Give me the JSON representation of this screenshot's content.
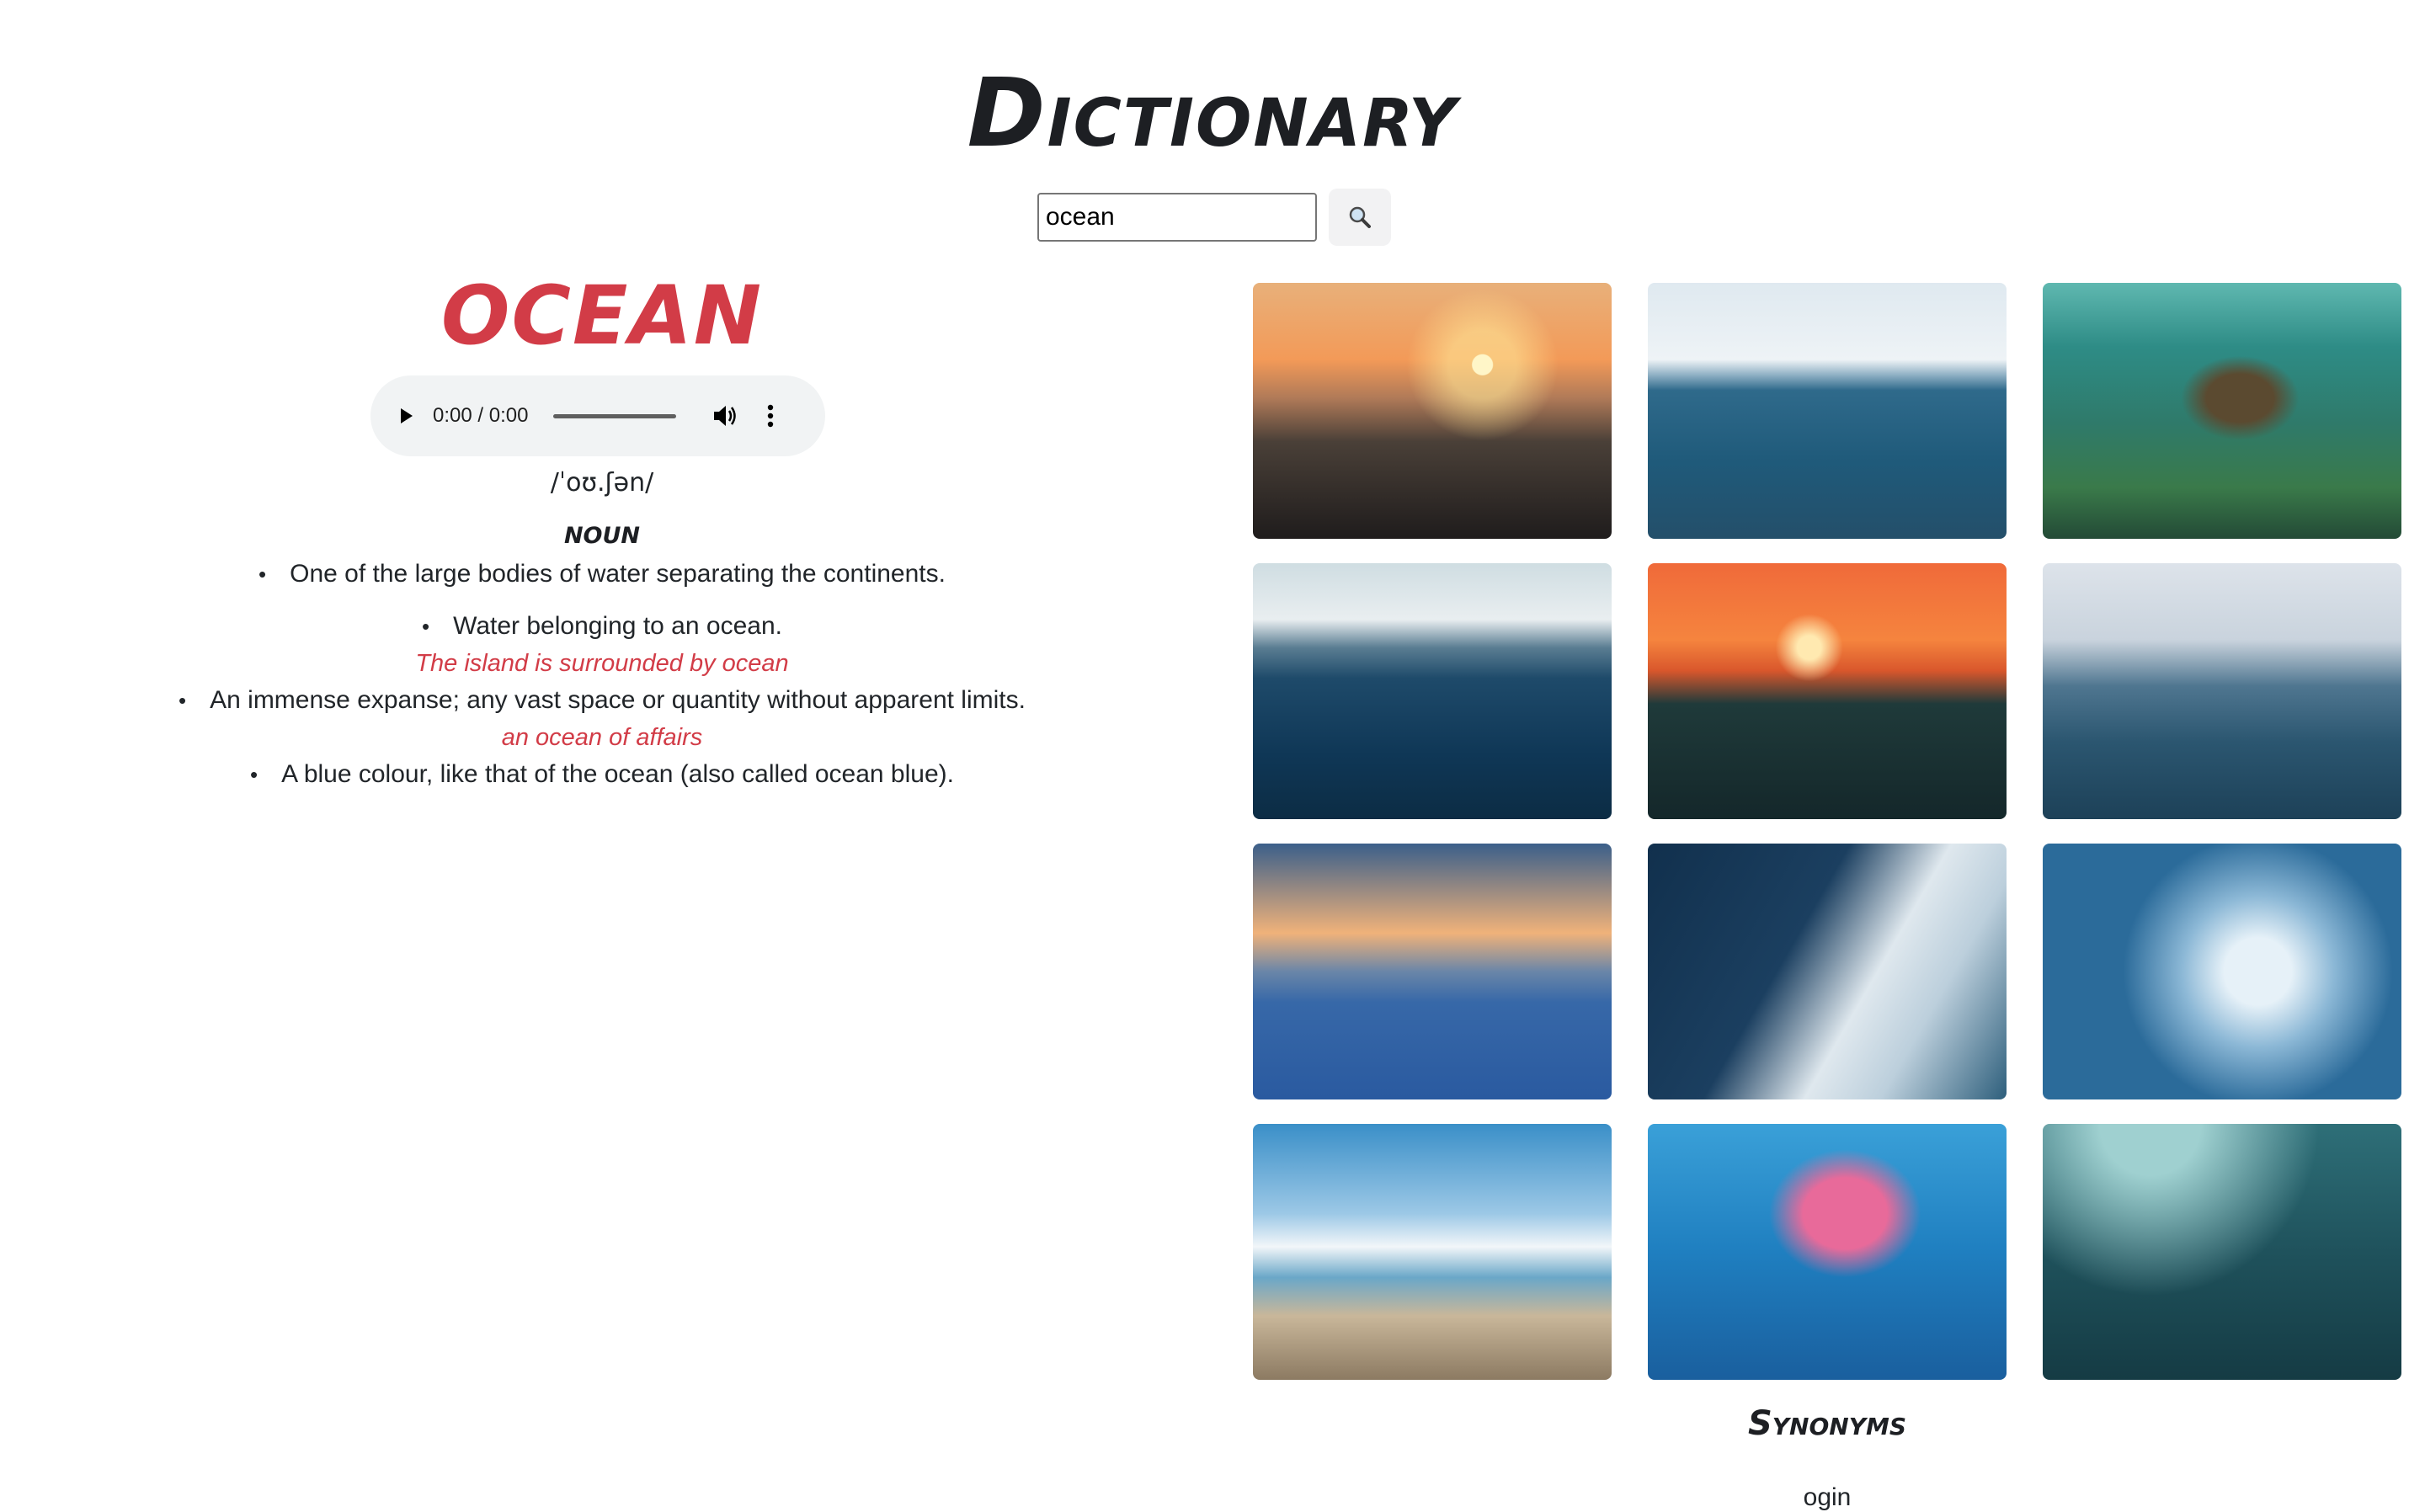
{
  "app": {
    "title": "Dictionary"
  },
  "search": {
    "value": "ocean",
    "button_icon": "search-icon"
  },
  "word": {
    "heading": "ocean",
    "audio": {
      "time": "0:00 / 0:00"
    },
    "phonetic": "/ˈoʊ.ʃən/",
    "part_of_speech": "noun",
    "definitions": [
      {
        "text": "One of the large bodies of water separating the continents.",
        "example": ""
      },
      {
        "text": "Water belonging to an ocean.",
        "example": "The island is surrounded by ocean"
      },
      {
        "text": "An immense expanse; any vast space or quantity without apparent limits.",
        "example": "an ocean of affairs"
      },
      {
        "text": "A blue colour, like that of the ocean (also called ocean blue).",
        "example": ""
      }
    ]
  },
  "photos": [
    {
      "subject": "sunset-waves"
    },
    {
      "subject": "open-sea"
    },
    {
      "subject": "sea-turtle"
    },
    {
      "subject": "rough-sea"
    },
    {
      "subject": "orange-sunset"
    },
    {
      "subject": "calm-water"
    },
    {
      "subject": "cloudy-horizon"
    },
    {
      "subject": "breaking-wave"
    },
    {
      "subject": "white-foam"
    },
    {
      "subject": "tropical-beach"
    },
    {
      "subject": "jellyfish"
    },
    {
      "subject": "underwater-light"
    }
  ],
  "synonyms": {
    "heading": "Synonyms",
    "items": [
      "ogin"
    ]
  },
  "colors": {
    "accent": "#d23c47",
    "text": "#212529",
    "title": "#1d1f23"
  }
}
